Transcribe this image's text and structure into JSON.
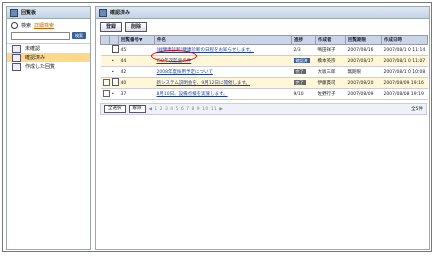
{
  "sidebar": {
    "title": "回覧板",
    "search_label": "検索",
    "advanced_search": "詳細検索",
    "search_button": "検索",
    "items": [
      {
        "label": "未確認"
      },
      {
        "label": "確認済み"
      },
      {
        "label": "作成した回覧"
      }
    ]
  },
  "main": {
    "title": "確認済み",
    "buttons": {
      "register": "登録",
      "delete": "削除"
    },
    "columns": [
      "",
      "",
      "回覧番号▼",
      "件名",
      "進捗",
      "作成者",
      "回覧期限",
      "作成日時"
    ],
    "rows": [
      {
        "no": "45",
        "subject": "[緑健康診断]健康診断の日程をお知らせします。",
        "progress": "2/3",
        "author": "鳴田祥子",
        "due": "2007/08/16",
        "created": "2007/08/1 0 11:14"
      },
      {
        "no": "44",
        "subject": "ISO年次監査の件",
        "progress": "確認済",
        "author": "橋本英宗",
        "due": "2007/08/17",
        "created": "2007/08/1 0 11:07"
      },
      {
        "no": "42",
        "subject": "2008年度採用予定について",
        "progress": "完了",
        "author": "大坂三郎",
        "due": "無期限",
        "created": "2007/08/1 0 10:08"
      },
      {
        "no": "40",
        "subject": "新システム説明会を、9月12日に開催します。",
        "progress": "完了",
        "author": "伊藤貫司",
        "due": "2007/08/20",
        "created": "2007/08/09 19:16"
      },
      {
        "no": "37",
        "subject": "8月10日、設備点検を実施します。",
        "progress": "9/10",
        "author": "佐野行子",
        "due": "2007/08/09",
        "created": "2007/08/08 19:19"
      }
    ],
    "pager": {
      "select_all": "全選択",
      "deselect": "解除",
      "pages": "◀ 1 2 3 4 5 6 7 8 9 10 11 ▶",
      "count": "全5件"
    }
  }
}
